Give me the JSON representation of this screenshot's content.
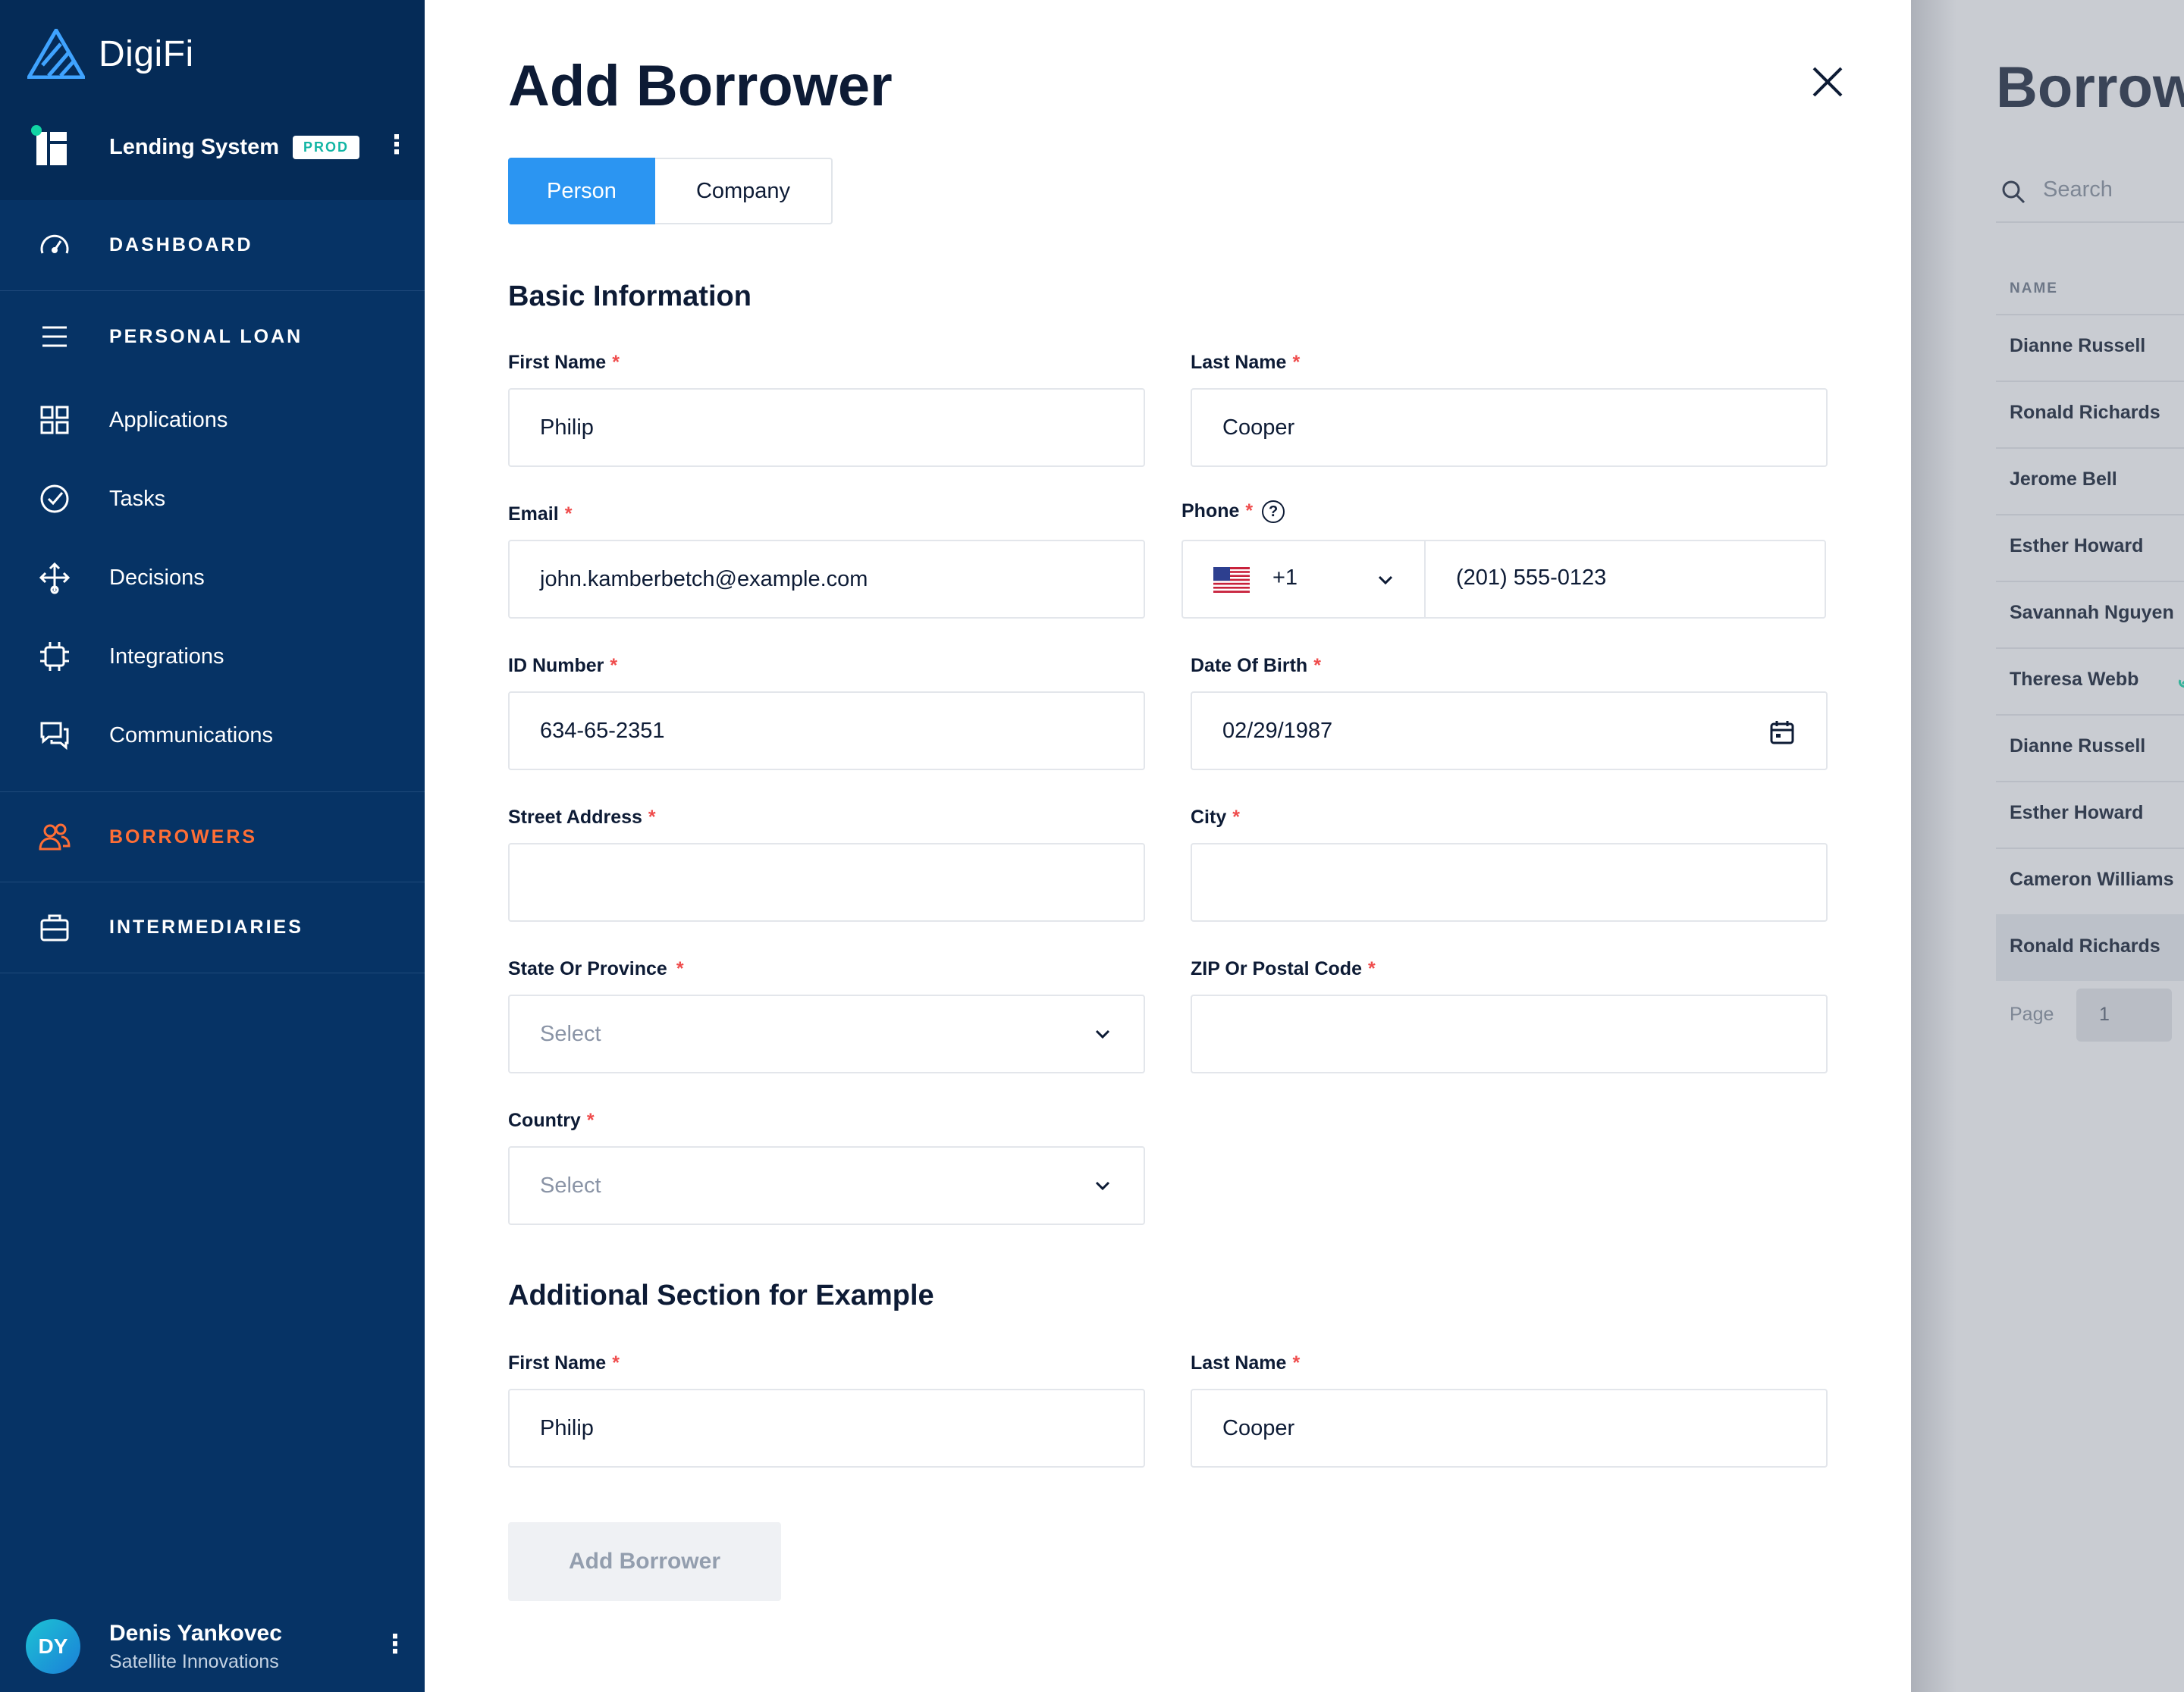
{
  "app": {
    "brand": "DigiFi",
    "system_name": "Lending System",
    "env_badge": "PROD"
  },
  "sidebar": {
    "sections": [
      {
        "label": "DASHBOARD",
        "icon": "speedometer-icon"
      },
      {
        "label": "PERSONAL LOAN",
        "icon": "menu-icon"
      }
    ],
    "items": [
      {
        "label": "Applications",
        "icon": "grid-icon"
      },
      {
        "label": "Tasks",
        "icon": "check-circle-icon"
      },
      {
        "label": "Decisions",
        "icon": "flow-icon"
      },
      {
        "label": "Integrations",
        "icon": "chip-icon"
      },
      {
        "label": "Communications",
        "icon": "chat-icon"
      }
    ],
    "borrowers": "BORROWERS",
    "intermediaries": "INTERMEDIARIES",
    "user": {
      "initials": "DY",
      "name": "Denis Yankovec",
      "org": "Satellite Innovations"
    }
  },
  "modal": {
    "title": "Add Borrower",
    "tabs": [
      "Person",
      "Company"
    ],
    "basic_title": "Basic Information",
    "fields": {
      "first_name": {
        "label": "First Name",
        "value": "Philip"
      },
      "last_name": {
        "label": "Last Name",
        "value": "Cooper"
      },
      "email": {
        "label": "Email",
        "value": "john.kamberbetch@example.com"
      },
      "phone": {
        "label": "Phone",
        "help": "?",
        "code": "+1",
        "value": "(201) 555-0123"
      },
      "id_number": {
        "label": "ID Number",
        "value": "634-65-2351"
      },
      "dob": {
        "label": "Date Of Birth",
        "value": "02/29/1987"
      },
      "street": {
        "label": "Street Address",
        "value": ""
      },
      "city": {
        "label": "City",
        "value": ""
      },
      "state": {
        "label": "State Or Province",
        "placeholder": "Select"
      },
      "zip": {
        "label": "ZIP Or Postal Code",
        "value": ""
      },
      "country": {
        "label": "Country",
        "placeholder": "Select"
      }
    },
    "additional_title": "Additional Section for Example",
    "additional": {
      "first_name": {
        "label": "First Name",
        "value": "Philip"
      },
      "last_name": {
        "label": "Last Name",
        "value": "Cooper"
      }
    },
    "required_mark": "*",
    "submit": "Add Borrower"
  },
  "background": {
    "title": "Borrow",
    "search_placeholder": "Search",
    "column": "NAME",
    "rows": [
      "Dianne Russell",
      "Ronald Richards",
      "Jerome Bell",
      "Esther Howard",
      "Savannah Nguyen",
      "Theresa Webb",
      "Dianne Russell",
      "Esther Howard",
      "Cameron Williams",
      "Ronald Richards"
    ],
    "page_label": "Page",
    "page_value": "1"
  },
  "colors": {
    "sidebar": "#063365",
    "accent_orange": "#ff6e35",
    "tab_active": "#2b95f2",
    "required": "#ef4c4c"
  }
}
